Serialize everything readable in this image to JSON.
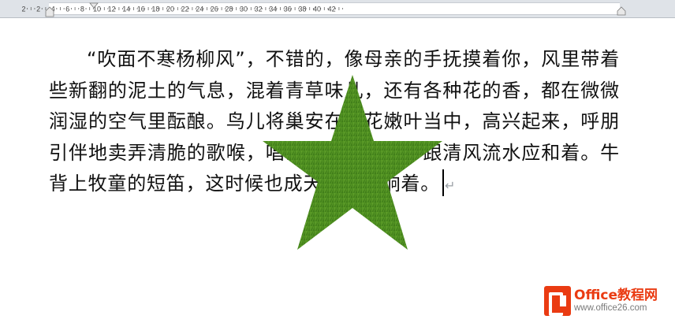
{
  "ruler": {
    "labels": [
      "2",
      "2",
      "4",
      "6",
      "8",
      "10",
      "12",
      "14",
      "16",
      "18",
      "20",
      "22",
      "24",
      "26",
      "28",
      "30",
      "32",
      "34",
      "36",
      "38",
      "40",
      "42"
    ]
  },
  "document": {
    "paragraph_lines": [
      "“吹面不寒杨柳风”，不错的，像母亲的手抚摸着你，",
      "风里带着些新翻的泥土的气息，混着青草味儿，还有各种花",
      "的香，都在微微润湿的空气里酝酿。鸟儿将巢安在繁花嫩叶",
      "当中，高兴起来，呼朋引伴地卖弄清脆的歌喉，唱出婉转的",
      "曲子，跟清风流水应和着。牛背上牧童的短笛，这时候也成",
      "天嘹亮的响着。"
    ],
    "pilcrow": "↵"
  },
  "shape": {
    "kind": "five-point-star",
    "fill": "#4a8a1e",
    "texture": "grass"
  },
  "watermark": {
    "brand": "Office教程网",
    "url": "www.office26.com",
    "accent": "#ea3b12"
  }
}
